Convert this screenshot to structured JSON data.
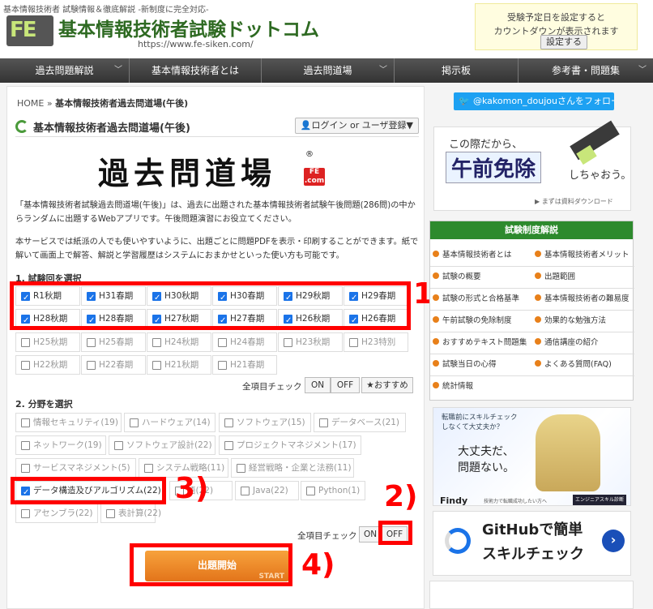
{
  "header": {
    "tagline": "基本情報技術者 試験情報＆徹底解説 -新制度に完全対応-",
    "logo_badge": "FE",
    "logo_title": "基本情報技術者試験ドットコム",
    "logo_url": "https://www.fe-siken.com/",
    "countdown_line1": "受験予定日を設定すると",
    "countdown_line2": "カウントダウンが表示されます",
    "countdown_button": "設定する"
  },
  "nav": [
    {
      "label": "過去問題解説"
    },
    {
      "label": "基本情報技術者とは"
    },
    {
      "label": "過去問道場"
    },
    {
      "label": "掲示板"
    },
    {
      "label": "参考書・問題集"
    }
  ],
  "breadcrumb": {
    "home": "HOME",
    "sep": "»",
    "current": "基本情報技術者過去問道場(午後)"
  },
  "page_title": "基本情報技術者過去問道場(午後)",
  "login_button": "ログイン or ユーザ登録▼",
  "dojo_logo": {
    "text": "過去問道場",
    "reg": "®",
    "badge": "FE .com"
  },
  "intro": {
    "p1": "「基本情報技術者試験過去問道場(午後)」は、過去に出題された基本情報技術者試験午後問題(286問)の中からランダムに出題するWebアプリです。午後問題演習にお役立てください。",
    "p2": "本サービスでは紙派の人でも使いやすいように、出題ごとに問題PDFを表示・印刷することができます。紙で解いて画面上で解答、解説と学習履歴はシステムにおまかせといった使い方も可能です。"
  },
  "exam_section": {
    "title": "1. 試験回を選択",
    "items": [
      {
        "label": "R1秋期",
        "checked": true
      },
      {
        "label": "H31春期",
        "checked": true
      },
      {
        "label": "H30秋期",
        "checked": true
      },
      {
        "label": "H30春期",
        "checked": true
      },
      {
        "label": "H29秋期",
        "checked": true
      },
      {
        "label": "H29春期",
        "checked": true
      },
      {
        "label": "H28秋期",
        "checked": true
      },
      {
        "label": "H28春期",
        "checked": true
      },
      {
        "label": "H27秋期",
        "checked": true
      },
      {
        "label": "H27春期",
        "checked": true
      },
      {
        "label": "H26秋期",
        "checked": true
      },
      {
        "label": "H26春期",
        "checked": true
      },
      {
        "label": "H25秋期",
        "checked": false
      },
      {
        "label": "H25春期",
        "checked": false
      },
      {
        "label": "H24秋期",
        "checked": false
      },
      {
        "label": "H24春期",
        "checked": false
      },
      {
        "label": "H23秋期",
        "checked": false
      },
      {
        "label": "H23特別",
        "checked": false
      },
      {
        "label": "H22秋期",
        "checked": false
      },
      {
        "label": "H22春期",
        "checked": false
      },
      {
        "label": "H21秋期",
        "checked": false
      },
      {
        "label": "H21春期",
        "checked": false
      }
    ],
    "check_all_label": "全項目チェック",
    "on": "ON",
    "off": "OFF",
    "recommend": "★おすすめ"
  },
  "field_section": {
    "title": "2. 分野を選択",
    "items": [
      {
        "label": "情報セキュリティ(19)",
        "checked": false
      },
      {
        "label": "ハードウェア(14)",
        "checked": false
      },
      {
        "label": "ソフトウェア(15)",
        "checked": false
      },
      {
        "label": "データベース(21)",
        "checked": false
      },
      {
        "label": "ネットワーク(19)",
        "checked": false
      },
      {
        "label": "ソフトウェア設計(22)",
        "checked": false
      },
      {
        "label": "プロジェクトマネジメント(17)",
        "checked": false
      },
      {
        "label": "サービスマネジメント(5)",
        "checked": false
      },
      {
        "label": "システム戦略(11)",
        "checked": false
      },
      {
        "label": "経営戦略・企業と法務(11)",
        "checked": false
      },
      {
        "label": "データ構造及びアルゴリズム(22)",
        "checked": true
      },
      {
        "label": "語(22)",
        "checked": false
      },
      {
        "label": "Java(22)",
        "checked": false
      },
      {
        "label": "Python(1)",
        "checked": false
      },
      {
        "label": "アセンブラ(22)",
        "checked": false
      },
      {
        "label": "表計算(22)",
        "checked": false
      }
    ],
    "check_all_label": "全項目チェック",
    "on": "ON",
    "off": "OFF"
  },
  "start_button": {
    "label": "出題開始",
    "sub": "START"
  },
  "annotations": {
    "n1": "1)",
    "n2": "2)",
    "n3": "3)",
    "n4": "4)"
  },
  "sidebar": {
    "twitter": "@kakomon_doujouさんをフォロー",
    "ad1": {
      "t1": "この際だから、",
      "t2": "午前免除",
      "t3": "しちゃおう。",
      "t4": "▶ まずは資料ダウンロード"
    },
    "menu_title": "試験制度解説",
    "menu": [
      "基本情報技術者とは",
      "基本情報技術者メリット",
      "試験の概要",
      "出題範囲",
      "試験の形式と合格基準",
      "基本情報技術者の難易度",
      "午前試験の免除制度",
      "効果的な勉強方法",
      "おすすめテキスト問題集",
      "通信講座の紹介",
      "試験当日の心得",
      "よくある質問(FAQ)",
      "統計情報"
    ],
    "ad2": {
      "t1a": "転職前にスキルチェック",
      "t1b": "しなくて大丈夫か？",
      "t2a": "大丈夫だ、",
      "t2b": "問題ない。",
      "brand": "Findy",
      "small": "技術力で転職成功したい方へ",
      "cta": "エンジニアスキル診断"
    },
    "ad3": {
      "t1": "GitHubで簡単",
      "t2": "スキルチェック",
      "arrow": "›"
    }
  }
}
